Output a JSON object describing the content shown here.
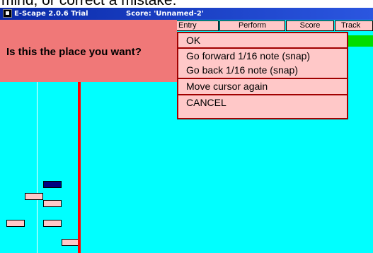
{
  "caption_fragment": "mind, or correct a mistake.",
  "window": {
    "app_title": "E-Scape 2.0.6 Trial",
    "score_title": "Score: 'Unnamed-2'"
  },
  "menubar": {
    "items": [
      {
        "label": "Entry"
      },
      {
        "label": "Perform"
      },
      {
        "label": "Score"
      },
      {
        "label": "Track"
      }
    ]
  },
  "prompt": {
    "text": "Is this the place you want?"
  },
  "popup": {
    "items": [
      {
        "label": "OK"
      },
      {
        "label": "Go forward 1/16 note (snap)"
      },
      {
        "label": "Go back 1/16 note (snap)"
      },
      {
        "label": "Move cursor again"
      },
      {
        "label": "CANCEL"
      }
    ]
  },
  "colors": {
    "canvas": "#00ffff",
    "prompt_panel": "#f07878",
    "menu_bg": "#ffc8c8",
    "cursor": "#ff0000",
    "note_selected": "#000080"
  },
  "notes": [
    {
      "style": "navy"
    },
    {
      "style": "pink"
    },
    {
      "style": "pink"
    },
    {
      "style": "pink"
    },
    {
      "style": "pink"
    },
    {
      "style": "pink"
    }
  ]
}
